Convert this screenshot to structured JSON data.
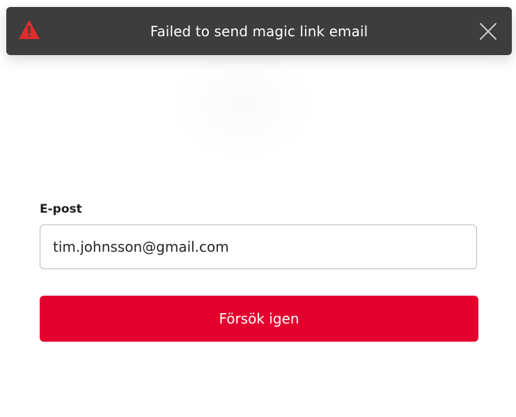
{
  "toast": {
    "message": "Failed to send magic link email",
    "icon": "warning-triangle-icon",
    "icon_color": "#e22b2b",
    "close_icon": "close-icon",
    "background_color": "#3d3d3d"
  },
  "form": {
    "email_label": "E-post",
    "email_value": "tim.johnsson@gmail.com",
    "submit_label": "Försök igen",
    "accent_color": "#e3002f"
  }
}
